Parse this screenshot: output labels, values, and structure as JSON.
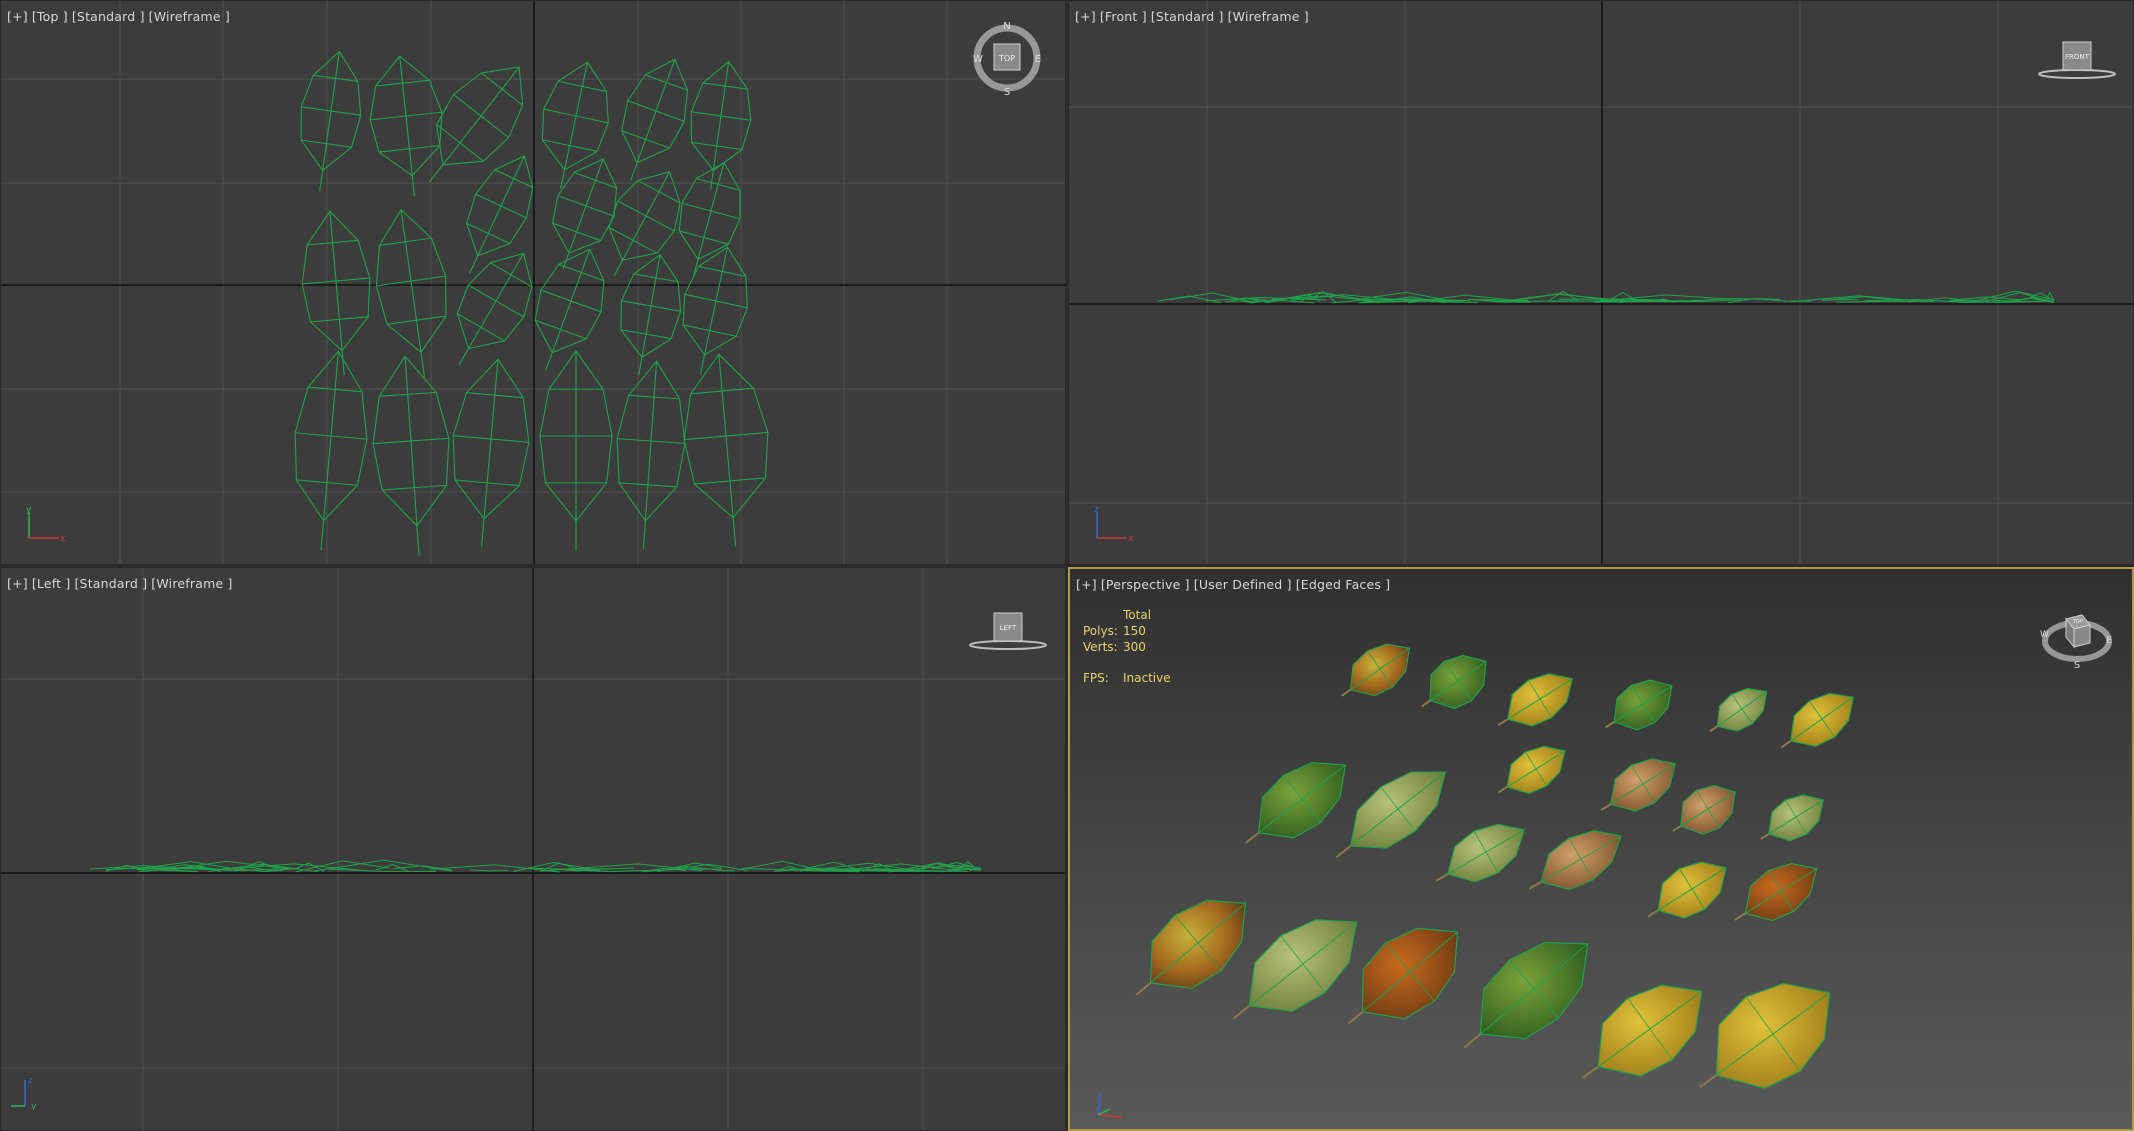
{
  "viewports": {
    "top": {
      "label": [
        "[+]",
        "[Top ]",
        "[Standard ]",
        "[Wireframe ]"
      ],
      "cube_text": "TOP",
      "compass": {
        "n": "N",
        "s": "S",
        "e": "E",
        "w": "W"
      },
      "axis": {
        "a": "y",
        "b": "x"
      }
    },
    "front": {
      "label": [
        "[+]",
        "[Front ]",
        "[Standard ]",
        "[Wireframe ]"
      ],
      "cube_text": "FRONT",
      "axis": {
        "a": "z",
        "b": "x"
      }
    },
    "left": {
      "label": [
        "[+]",
        "[Left ]",
        "[Standard ]",
        "[Wireframe ]"
      ],
      "cube_text": "LEFT",
      "axis": {
        "a": "z",
        "b": "y"
      }
    },
    "perspective": {
      "label": [
        "[+]",
        "[Perspective ]",
        "[User Defined ]",
        "[Edged Faces ]"
      ],
      "stats": {
        "header": "Total",
        "polys_label": "Polys:",
        "polys": "150",
        "verts_label": "Verts:",
        "verts": "300",
        "fps_label": "FPS:",
        "fps": "Inactive"
      },
      "cube_text": "TOP",
      "compass": {
        "s": "S",
        "e": "E",
        "w": "W"
      }
    }
  },
  "colors": {
    "wire": "#1fa24a",
    "grid": "#525252",
    "axis_line": "#0f0f0f",
    "border_active": "#b39a45",
    "stats_text": "#e7d36a"
  }
}
